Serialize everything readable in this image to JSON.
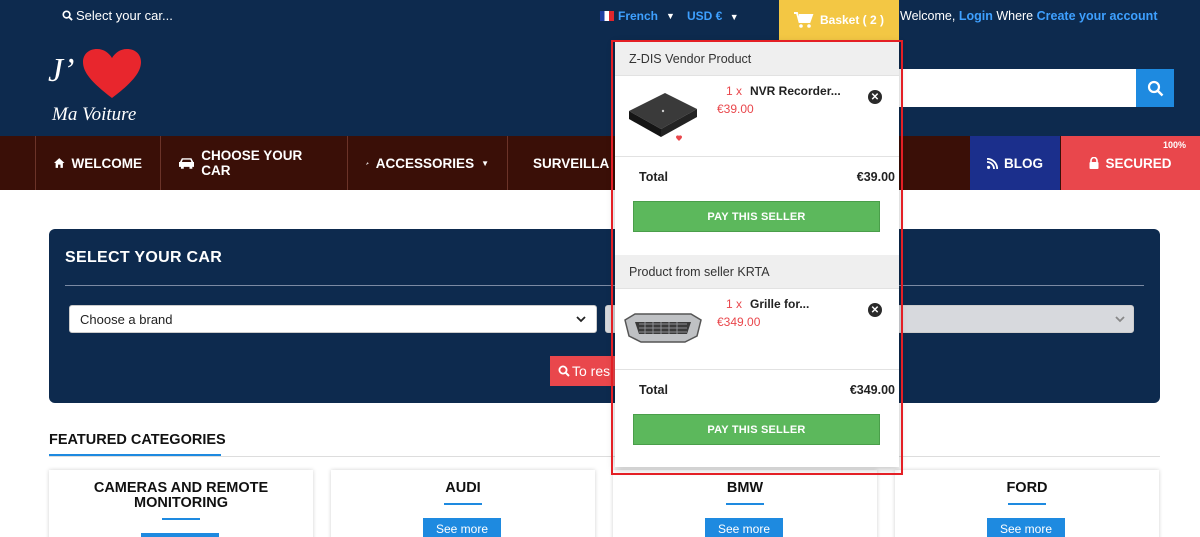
{
  "topbar": {
    "search_text": "Select your car...",
    "language": "French",
    "currency": "USD €",
    "basket_label": "Basket ( 2 )",
    "welcome_text": "Welcome, ",
    "login_label": "Login",
    "where_text": " Where ",
    "create_account_label": "Create your account"
  },
  "logo": {
    "j_text": "J’",
    "subtitle": "Ma Voiture"
  },
  "nav": {
    "items": [
      {
        "label": "WELCOME",
        "icon": "home-icon"
      },
      {
        "label": "CHOOSE YOUR CAR",
        "icon": "car-icon"
      },
      {
        "label": "ACCESSORIES",
        "icon": "wrench-icon"
      },
      {
        "label": "SURVEILLA",
        "icon": "video-icon"
      }
    ],
    "blog_label": "BLOG",
    "secured_label": "SECURED",
    "secured_badge": "100%"
  },
  "car_select": {
    "title": "SELECT YOUR CAR",
    "brand_placeholder": "Choose a brand",
    "research_label": "To res"
  },
  "featured": {
    "title": "FEATURED CATEGORIES",
    "categories": [
      {
        "name": "CAMERAS AND REMOTE MONITORING",
        "button": ""
      },
      {
        "name": "AUDI",
        "button": "See more"
      },
      {
        "name": "BMW",
        "button": "See more"
      },
      {
        "name": "FORD",
        "button": "See more"
      }
    ]
  },
  "cart_dropdown": {
    "sellers": [
      {
        "header": "Z-DIS Vendor Product",
        "item": {
          "qty": "1  x",
          "name": "NVR Recorder...",
          "price": "€39.00"
        },
        "total_label": "Total",
        "total_value": "€39.00",
        "pay_label": "PAY THIS SELLER"
      },
      {
        "header": "Product from seller KRTA",
        "item": {
          "qty": "1  x",
          "name": "Grille for...",
          "price": "€349.00"
        },
        "total_label": "Total",
        "total_value": "€349.00",
        "pay_label": "PAY THIS SELLER"
      }
    ]
  },
  "colors": {
    "navy": "#0d2a4e",
    "nav_brown": "#3a0f07",
    "accent_blue": "#1e8ae0",
    "basket_yellow": "#f3c744",
    "red": "#e9474c",
    "pay_green": "#5cb85c",
    "highlight_red": "#e41f25"
  }
}
